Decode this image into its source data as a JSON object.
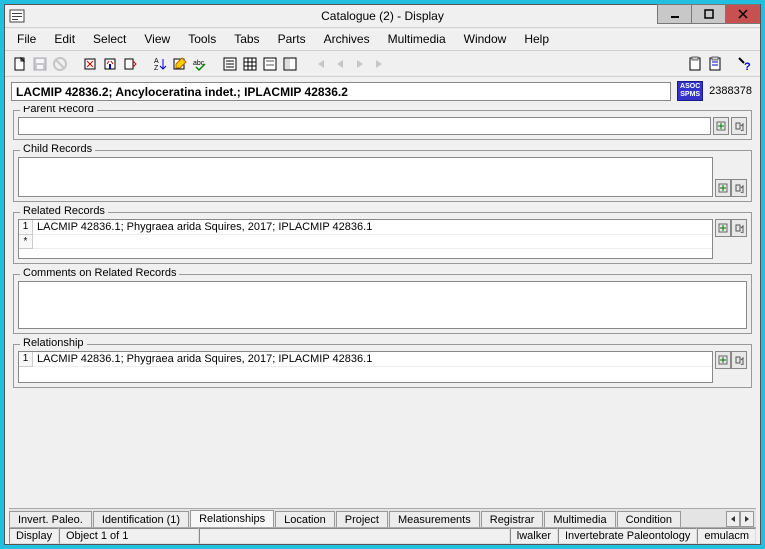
{
  "window": {
    "title": "Catalogue (2) - Display"
  },
  "menubar": [
    "File",
    "Edit",
    "Select",
    "View",
    "Tools",
    "Tabs",
    "Parts",
    "Archives",
    "Multimedia",
    "Window",
    "Help"
  ],
  "header": {
    "text": "LACMIP 42836.2; Ancyloceratina indet.; IPLACMIP 42836.2",
    "badge": "ASOC\nSPMS",
    "record_id": "2388378"
  },
  "groups": {
    "parent": {
      "label": "Parent Record",
      "value": ""
    },
    "child": {
      "label": "Child Records",
      "rows": []
    },
    "related": {
      "label": "Related Records",
      "rows": [
        {
          "gutter": "1",
          "text": "LACMIP 42836.1; Phygraea arida Squires, 2017; IPLACMIP 42836.1"
        },
        {
          "gutter": "*",
          "text": ""
        }
      ]
    },
    "comments": {
      "label": "Comments on Related Records",
      "value": ""
    },
    "relationship": {
      "label": "Relationship",
      "rows": [
        {
          "gutter": "1",
          "text": "LACMIP 42836.1; Phygraea arida Squires, 2017; IPLACMIP 42836.1"
        }
      ]
    }
  },
  "tabs": [
    "Invert. Paleo.",
    "Identification (1)",
    "Relationships",
    "Location",
    "Project",
    "Measurements",
    "Registrar",
    "Multimedia",
    "Condition"
  ],
  "active_tab": 2,
  "status": {
    "mode": "Display",
    "pos": "Object 1 of 1",
    "user": "lwalker",
    "dept": "Invertebrate Paleontology",
    "db": "emulacm"
  }
}
